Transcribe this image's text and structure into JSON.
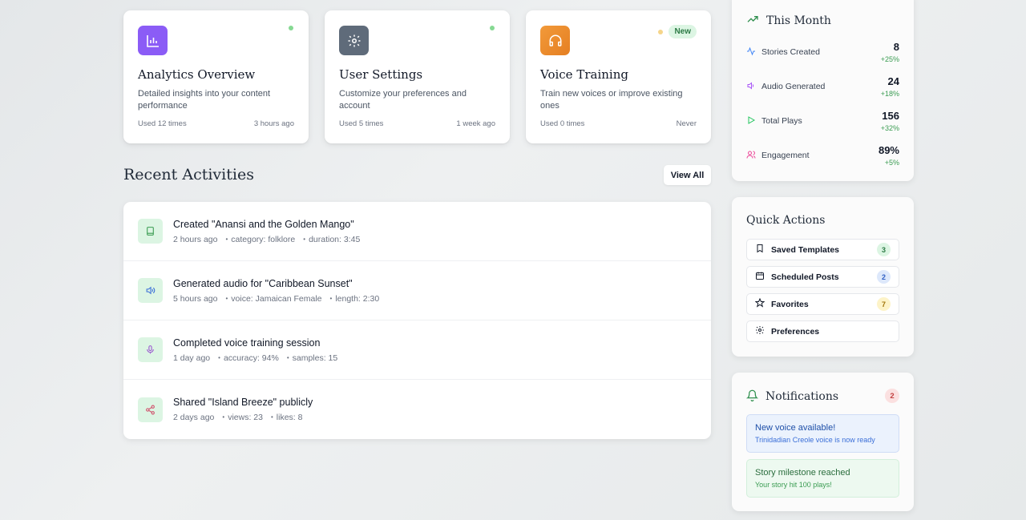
{
  "feature_cards": [
    {
      "title": "Analytics Overview",
      "description": "Detailed insights into your content performance",
      "usage": "Used 12 times",
      "last_used": "3 hours ago",
      "icon": "bar-chart-icon",
      "icon_color": "#7c5cf0",
      "status": "active"
    },
    {
      "title": "User Settings",
      "description": "Customize your preferences and account",
      "usage": "Used 5 times",
      "last_used": "1 week ago",
      "icon": "gear-icon",
      "icon_color": "#5f6b7a",
      "status": "active"
    },
    {
      "title": "Voice Training",
      "description": "Train new voices or improve existing ones",
      "usage": "Used 0 times",
      "last_used": "Never",
      "icon": "headphones-icon",
      "icon_color": "#ea8a2e",
      "badge": "New"
    }
  ],
  "recent_activities": {
    "title": "Recent Activities",
    "view_all_label": "View All",
    "items": [
      {
        "title": "Created \"Anansi and the Golden Mango\"",
        "time": "2 hours ago",
        "meta1": "category: folklore",
        "meta2": "duration: 3:45",
        "icon": "book-icon"
      },
      {
        "title": "Generated audio for \"Caribbean Sunset\"",
        "time": "5 hours ago",
        "meta1": "voice: Jamaican Female",
        "meta2": "length: 2:30",
        "icon": "speaker-icon"
      },
      {
        "title": "Completed voice training session",
        "time": "1 day ago",
        "meta1": "accuracy: 94%",
        "meta2": "samples: 15",
        "icon": "microphone-icon"
      },
      {
        "title": "Shared \"Island Breeze\" publicly",
        "time": "2 days ago",
        "meta1": "views: 23",
        "meta2": "likes: 8",
        "icon": "share-icon"
      }
    ]
  },
  "this_month": {
    "title": "This Month",
    "stats": [
      {
        "label": "Stories Created",
        "value": "8",
        "delta": "+25%",
        "icon": "activity-icon",
        "color": "#3b82f6"
      },
      {
        "label": "Audio Generated",
        "value": "24",
        "delta": "+18%",
        "icon": "speaker-icon",
        "color": "#a855f7"
      },
      {
        "label": "Total Plays",
        "value": "156",
        "delta": "+32%",
        "icon": "play-icon",
        "color": "#22c55e"
      },
      {
        "label": "Engagement",
        "value": "89%",
        "delta": "+5%",
        "icon": "users-icon",
        "color": "#ec4899"
      }
    ]
  },
  "quick_actions": {
    "title": "Quick Actions",
    "items": [
      {
        "label": "Saved Templates",
        "count": "3",
        "icon": "bookmark-icon",
        "count_bg": "#dcf5e3",
        "count_color": "#2c7a45"
      },
      {
        "label": "Scheduled Posts",
        "count": "2",
        "icon": "calendar-icon",
        "count_bg": "#dde8fb",
        "count_color": "#2f5fc4"
      },
      {
        "label": "Favorites",
        "count": "7",
        "icon": "star-icon",
        "count_bg": "#fdf3c8",
        "count_color": "#a1740b"
      },
      {
        "label": "Preferences",
        "count": "",
        "icon": "gear-icon"
      }
    ]
  },
  "notifications": {
    "title": "Notifications",
    "count": "2",
    "items": [
      {
        "title": "New voice available!",
        "body": "Trinidadian Creole voice is now ready",
        "type": "info"
      },
      {
        "title": "Story milestone reached",
        "body": "Your story hit 100 plays!",
        "type": "success"
      }
    ]
  }
}
